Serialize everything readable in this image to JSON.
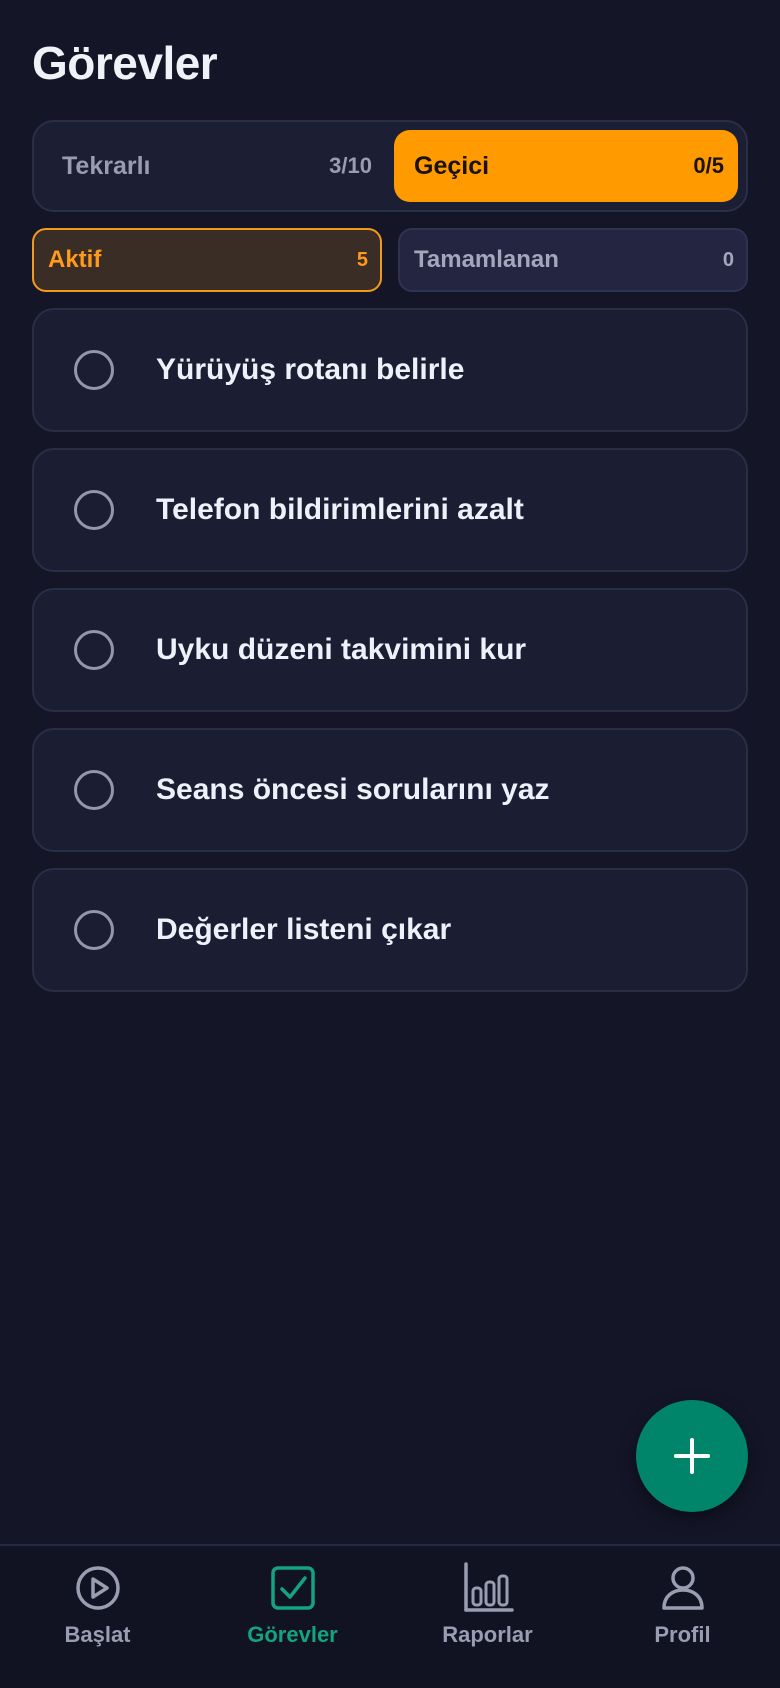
{
  "header": {
    "title": "Görevler"
  },
  "segments": [
    {
      "label": "Tekrarlı",
      "count": "3/10",
      "active": false
    },
    {
      "label": "Geçici",
      "count": "0/5",
      "active": true
    }
  ],
  "filters": [
    {
      "label": "Aktif",
      "count": "5",
      "active": true
    },
    {
      "label": "Tamamlanan",
      "count": "0",
      "active": false
    }
  ],
  "tasks": [
    {
      "title": "Yürüyüş rotanı belirle",
      "done": false
    },
    {
      "title": "Telefon bildirimlerini azalt",
      "done": false
    },
    {
      "title": "Uyku düzeni takvimini kur",
      "done": false
    },
    {
      "title": "Seans öncesi sorularını yaz",
      "done": false
    },
    {
      "title": "Değerler listeni çıkar",
      "done": false
    }
  ],
  "fab": {
    "icon": "plus-icon"
  },
  "nav": {
    "items": [
      {
        "label": "Başlat",
        "icon": "play-circle-icon",
        "active": false
      },
      {
        "label": "Görevler",
        "icon": "checkbox-icon",
        "active": true
      },
      {
        "label": "Raporlar",
        "icon": "bar-chart-icon",
        "active": false
      },
      {
        "label": "Profil",
        "icon": "person-icon",
        "active": false
      }
    ]
  },
  "colors": {
    "background": "#141628",
    "accent_orange": "#ff9a00",
    "accent_green": "#00856a",
    "active_nav": "#14a37f"
  }
}
